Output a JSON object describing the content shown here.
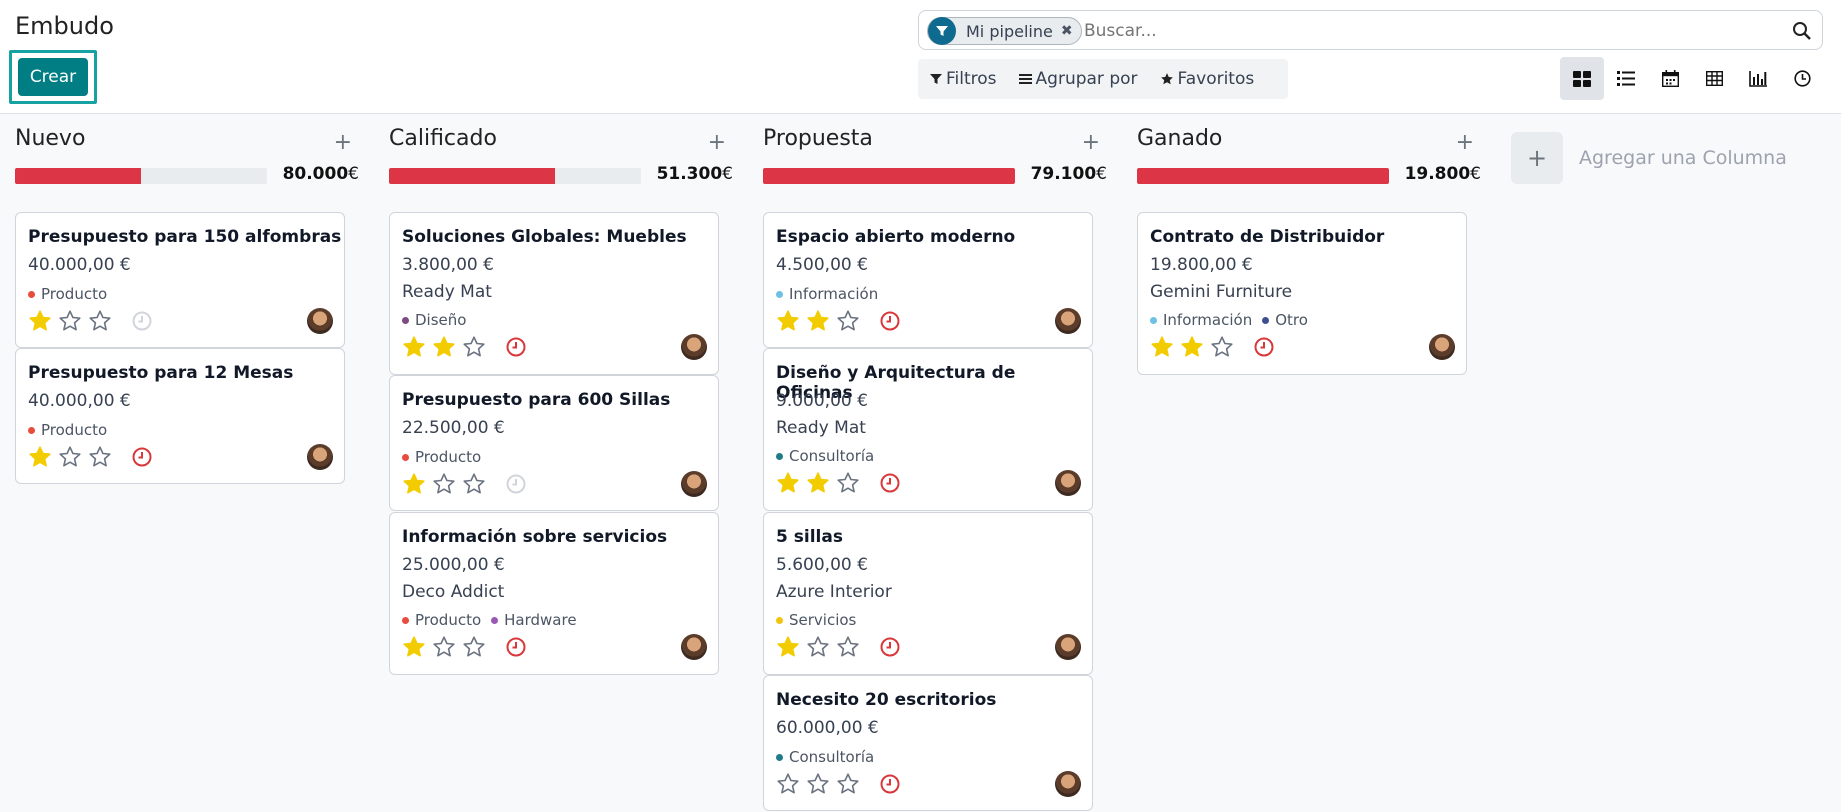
{
  "header": {
    "title": "Embudo",
    "create_label": "Crear"
  },
  "search": {
    "facet": "Mi pipeline",
    "placeholder": "Buscar..."
  },
  "filters": {
    "filters_label": "Filtros",
    "groupby_label": "Agrupar por",
    "favorites_label": "Favoritos"
  },
  "views": [
    "kanban-icon",
    "list-icon",
    "calendar-icon",
    "pivot-icon",
    "graph-icon",
    "activity-icon"
  ],
  "colors": {
    "accent": "#017e84",
    "progress": "#dc3545",
    "star": "#f3cc00",
    "clock_overdue": "#d9383a"
  },
  "columns": [
    {
      "title": "Nuevo",
      "total": "80.000",
      "currency": "€",
      "progress": 0.5,
      "cards": [
        {
          "name": "Presupuesto para 150 alfombras",
          "amount": "40.000,00 €",
          "partner": "",
          "tags": [
            {
              "label": "Producto",
              "color": "#e74c3c"
            }
          ],
          "stars": 1,
          "clock": "none"
        },
        {
          "name": "Presupuesto para 12 Mesas",
          "amount": "40.000,00 €",
          "partner": "",
          "tags": [
            {
              "label": "Producto",
              "color": "#e74c3c"
            }
          ],
          "stars": 1,
          "clock": "overdue"
        }
      ]
    },
    {
      "title": "Calificado",
      "total": "51.300",
      "currency": "€",
      "progress": 0.66,
      "cards": [
        {
          "name": "Soluciones Globales: Muebles",
          "amount": "3.800,00 €",
          "partner": "Ready Mat",
          "tags": [
            {
              "label": "Diseño",
              "color": "#7b4a7e"
            }
          ],
          "stars": 2,
          "clock": "overdue"
        },
        {
          "name": "Presupuesto para 600 Sillas",
          "amount": "22.500,00 €",
          "partner": "",
          "tags": [
            {
              "label": "Producto",
              "color": "#e74c3c"
            }
          ],
          "stars": 1,
          "clock": "none"
        },
        {
          "name": "Información sobre servicios",
          "amount": "25.000,00 €",
          "partner": "Deco Addict",
          "tags": [
            {
              "label": "Producto",
              "color": "#e74c3c"
            },
            {
              "label": "Hardware",
              "color": "#9b59b6"
            }
          ],
          "stars": 1,
          "clock": "overdue"
        }
      ]
    },
    {
      "title": "Propuesta",
      "total": "79.100",
      "currency": "€",
      "progress": 1.0,
      "cards": [
        {
          "name": "Espacio abierto moderno",
          "amount": "4.500,00 €",
          "partner": "",
          "tags": [
            {
              "label": "Información",
              "color": "#6ec1e4"
            }
          ],
          "stars": 2,
          "clock": "overdue"
        },
        {
          "name": "Diseño y Arquitectura de Oficinas",
          "amount": "9.000,00 €",
          "partner": "Ready Mat",
          "tags": [
            {
              "label": "Consultoría",
              "color": "#1f7c87"
            }
          ],
          "stars": 2,
          "clock": "overdue"
        },
        {
          "name": "5 sillas",
          "amount": "5.600,00 €",
          "partner": "Azure Interior",
          "tags": [
            {
              "label": "Servicios",
              "color": "#f1c40f"
            }
          ],
          "stars": 1,
          "clock": "overdue"
        },
        {
          "name": "Necesito 20 escritorios",
          "amount": "60.000,00 €",
          "partner": "",
          "tags": [
            {
              "label": "Consultoría",
              "color": "#1f7c87"
            }
          ],
          "stars": 0,
          "clock": "overdue"
        }
      ]
    },
    {
      "title": "Ganado",
      "total": "19.800",
      "currency": "€",
      "progress": 1.0,
      "cards": [
        {
          "name": "Contrato de Distribuidor",
          "amount": "19.800,00 €",
          "partner": "Gemini Furniture",
          "tags": [
            {
              "label": "Información",
              "color": "#6ec1e4"
            },
            {
              "label": "Otro",
              "color": "#3d4f8f"
            }
          ],
          "stars": 2,
          "clock": "overdue"
        }
      ]
    }
  ],
  "add_column_label": "Agregar una Columna"
}
